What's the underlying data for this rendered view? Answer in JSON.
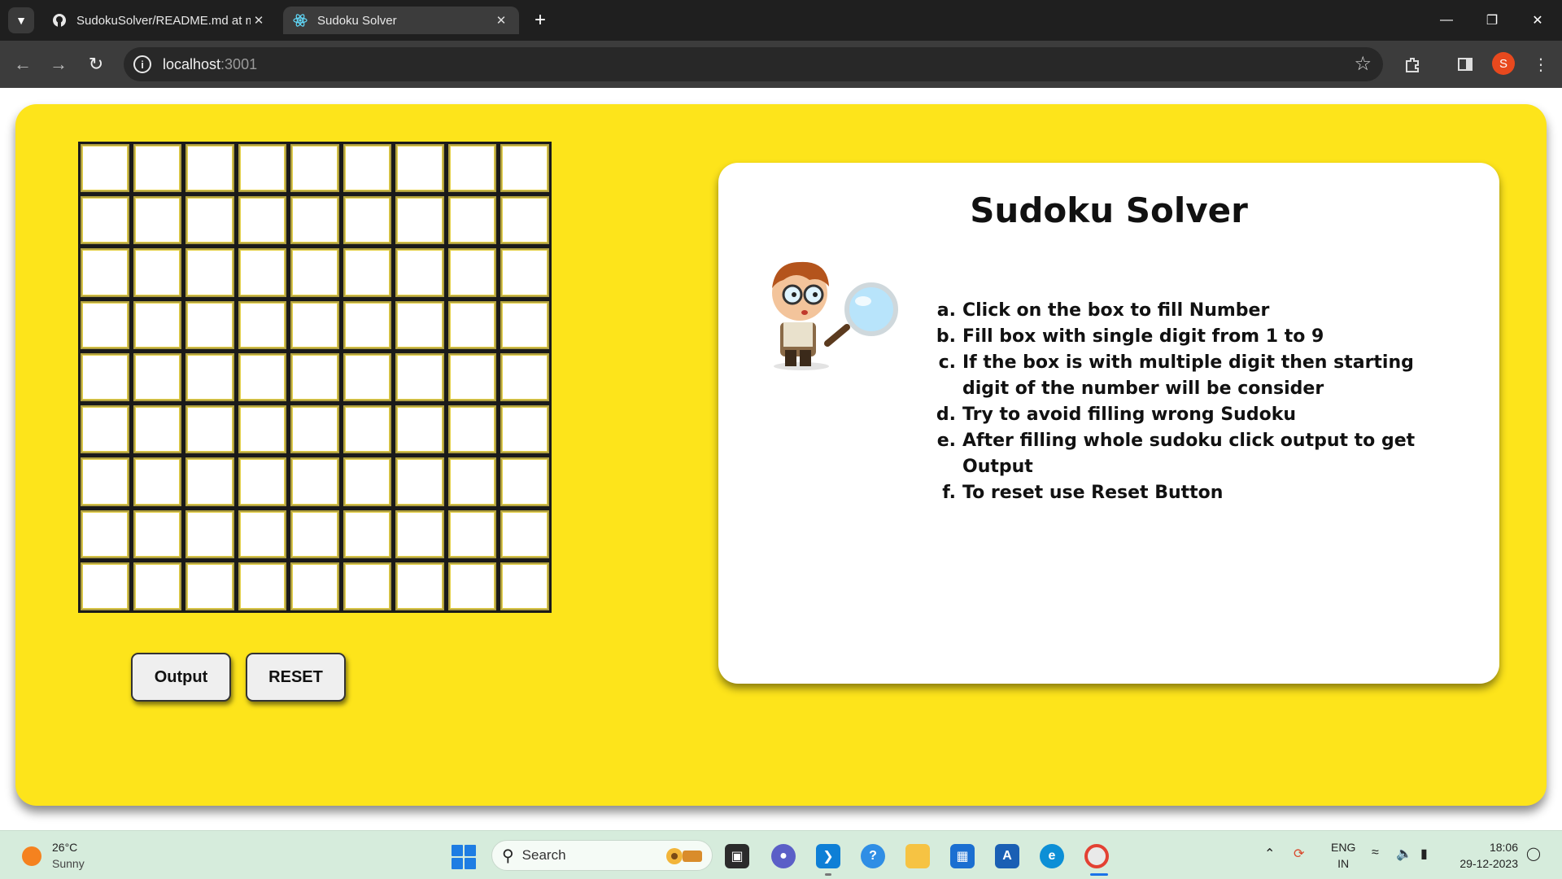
{
  "browser": {
    "tabs": [
      {
        "title": "SudokuSolver/README.md at m",
        "icon": "github-icon"
      },
      {
        "title": "Sudoku Solver",
        "icon": "react-icon"
      }
    ],
    "new_tab": "+",
    "address": {
      "host": "localhost",
      "port": ":3001"
    },
    "profile_initial": "S"
  },
  "sudoku": {
    "rows": 9,
    "cols": 9,
    "cells": [
      [
        "",
        "",
        "",
        "",
        "",
        "",
        "",
        "",
        ""
      ],
      [
        "",
        "",
        "",
        "",
        "",
        "",
        "",
        "",
        ""
      ],
      [
        "",
        "",
        "",
        "",
        "",
        "",
        "",
        "",
        ""
      ],
      [
        "",
        "",
        "",
        "",
        "",
        "",
        "",
        "",
        ""
      ],
      [
        "",
        "",
        "",
        "",
        "",
        "",
        "",
        "",
        ""
      ],
      [
        "",
        "",
        "",
        "",
        "",
        "",
        "",
        "",
        ""
      ],
      [
        "",
        "",
        "",
        "",
        "",
        "",
        "",
        "",
        ""
      ],
      [
        "",
        "",
        "",
        "",
        "",
        "",
        "",
        "",
        ""
      ],
      [
        "",
        "",
        "",
        "",
        "",
        "",
        "",
        "",
        ""
      ]
    ]
  },
  "buttons": {
    "output": "Output",
    "reset": "RESET"
  },
  "info": {
    "title": "Sudoku Solver",
    "mascot_icon": "detective-magnifier-icon",
    "steps": [
      {
        "mark": "a.",
        "text": "Click on the box to fill Number"
      },
      {
        "mark": "b.",
        "text": "Fill box with single digit from 1 to 9"
      },
      {
        "mark": "c.",
        "text": "If the box is with multiple digit then starting digit of the number will be consider"
      },
      {
        "mark": "d.",
        "text": "Try to avoid filling wrong Sudoku"
      },
      {
        "mark": "e.",
        "text": "After filling whole sudoku click output to get Output"
      },
      {
        "mark": "f.",
        "text": "To reset use Reset Button"
      }
    ]
  },
  "colors": {
    "page_card": "#fde41b",
    "grid_border": "#1a1a1a",
    "info_card": "#ffffff"
  },
  "taskbar": {
    "weather": {
      "temp": "26°C",
      "condition": "Sunny"
    },
    "search_placeholder": "Search",
    "language": {
      "line1": "ENG",
      "line2": "IN"
    },
    "time": "18:06",
    "date": "29-12-2023"
  }
}
